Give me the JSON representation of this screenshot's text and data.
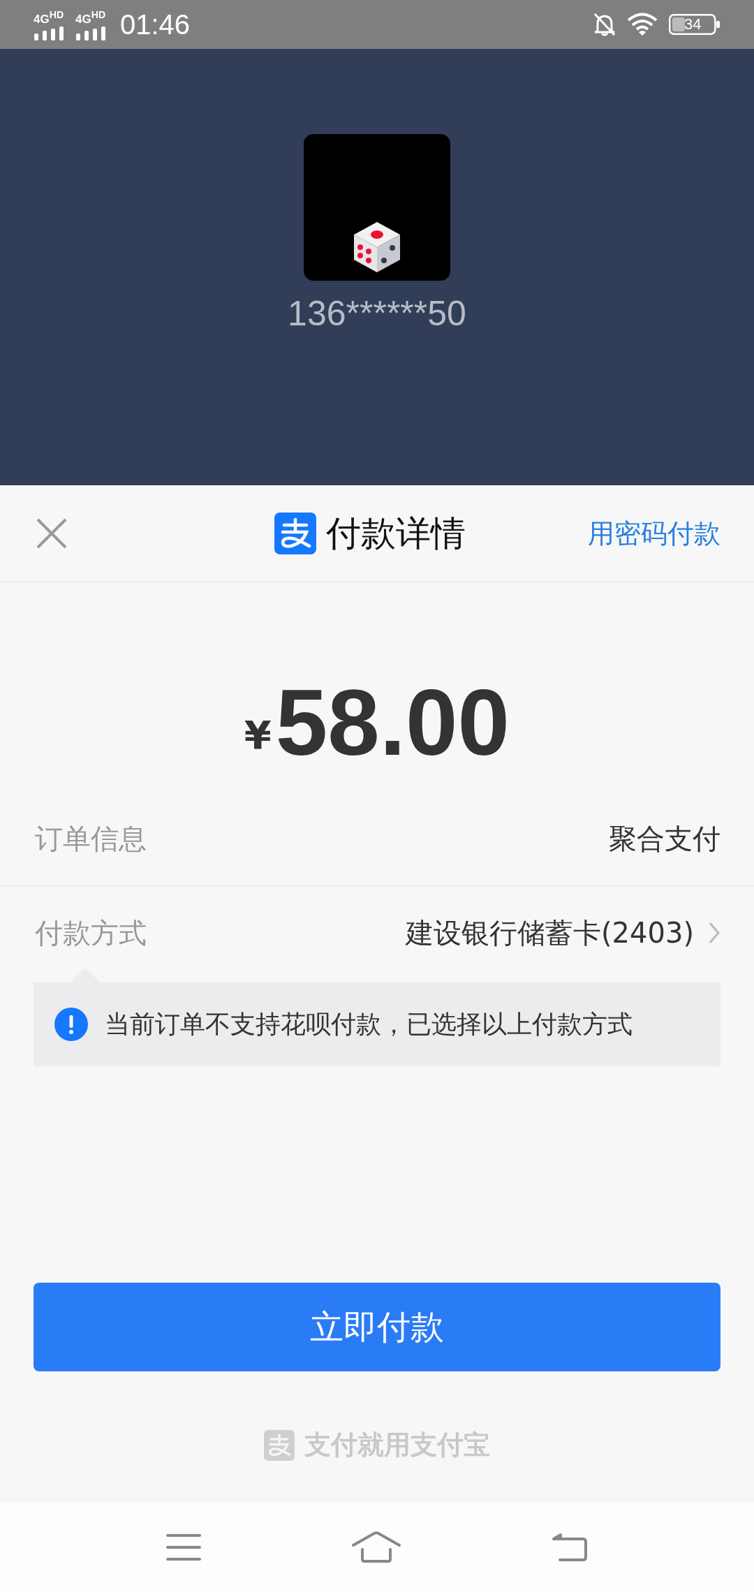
{
  "status_bar": {
    "networks": [
      "4G$^{HD}$",
      "4G$^{HD}$"
    ],
    "time": "01:46",
    "battery": "34"
  },
  "merchant": {
    "account": "136******50"
  },
  "header": {
    "title": "付款详情",
    "action": "用密码付款"
  },
  "amount": {
    "currency": "¥",
    "value": "58.00"
  },
  "rows": [
    {
      "label": "订单信息",
      "value": "聚合支付",
      "chevron": false
    },
    {
      "label": "付款方式",
      "value": "建设银行储蓄卡(2403)",
      "chevron": true
    }
  ],
  "notice": "当前订单不支持花呗付款，已选择以上付款方式",
  "pay_button": "立即付款",
  "footer": "支付就用支付宝"
}
